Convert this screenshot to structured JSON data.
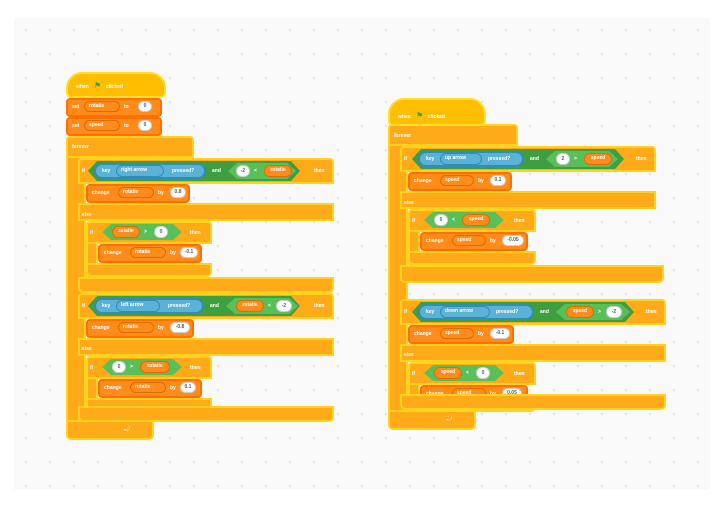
{
  "colors": {
    "events": "#FFBF00",
    "control": "#FFAB19",
    "variables": "#FF8C1A",
    "sensing": "#5CB1D6",
    "operators": "#59C059"
  },
  "icons": {
    "flag": "green-flag-icon",
    "loop": "loop-arrow-icon"
  },
  "scripts": [
    {
      "hat": {
        "when": "when",
        "clicked": "clicked"
      },
      "set_blocks": [
        {
          "verb": "set",
          "var": "rotatie",
          "to": "to",
          "value": "0"
        },
        {
          "verb": "set",
          "var": "speed",
          "to": "to",
          "value": "0"
        }
      ],
      "forever": "forever",
      "if1": {
        "if": "if",
        "key": "key",
        "key_name": "right arrow",
        "pressed": "pressed?",
        "and": "and",
        "left": "-2",
        "op": "<",
        "right": "rotatie",
        "then": "then",
        "body": {
          "verb": "change",
          "var": "rotatie",
          "by": "by",
          "value": "0.8"
        },
        "else": "else",
        "inner": {
          "if": "if",
          "left": "rotatie",
          "op": ">",
          "right": "0",
          "then": "then",
          "body": {
            "verb": "change",
            "var": "rotatie",
            "by": "by",
            "value": "-0.1"
          }
        }
      },
      "if2": {
        "if": "if",
        "key": "key",
        "key_name": "left arrow",
        "pressed": "pressed?",
        "and": "and",
        "left": "rotatie",
        "op": "<",
        "right": "-2",
        "then": "then",
        "body": {
          "verb": "change",
          "var": "rotatie",
          "by": "by",
          "value": "-0.8"
        },
        "else": "else",
        "inner": {
          "if": "if",
          "left": "0",
          "op": ">",
          "right": "rotatie",
          "then": "then",
          "body": {
            "verb": "change",
            "var": "rotatie",
            "by": "by",
            "value": "0.1"
          }
        }
      }
    },
    {
      "hat": {
        "when": "when",
        "clicked": "clicked"
      },
      "forever": "forever",
      "if1": {
        "if": "if",
        "key": "key",
        "key_name": "up arrow",
        "pressed": "pressed?",
        "and": "and",
        "left": "2",
        "op": ">",
        "right": "speed",
        "then": "then",
        "body": {
          "verb": "change",
          "var": "speed",
          "by": "by",
          "value": "0.1"
        },
        "else": "else",
        "inner": {
          "if": "if",
          "left": "0",
          "op": "<",
          "right": "speed",
          "then": "then",
          "body": {
            "verb": "change",
            "var": "speed",
            "by": "by",
            "value": "-0.05"
          }
        }
      },
      "if2": {
        "if": "if",
        "key": "key",
        "key_name": "down arrow",
        "pressed": "pressed?",
        "and": "and",
        "left": "speed",
        "op": ">",
        "right": "-2",
        "then": "then",
        "body": {
          "verb": "change",
          "var": "speed",
          "by": "by",
          "value": "-0.1"
        },
        "else": "else",
        "inner": {
          "if": "if",
          "left": "speed",
          "op": "<",
          "right": "0",
          "then": "then",
          "body": {
            "verb": "change",
            "var": "speed",
            "by": "by",
            "value": "0.05"
          }
        }
      }
    }
  ]
}
